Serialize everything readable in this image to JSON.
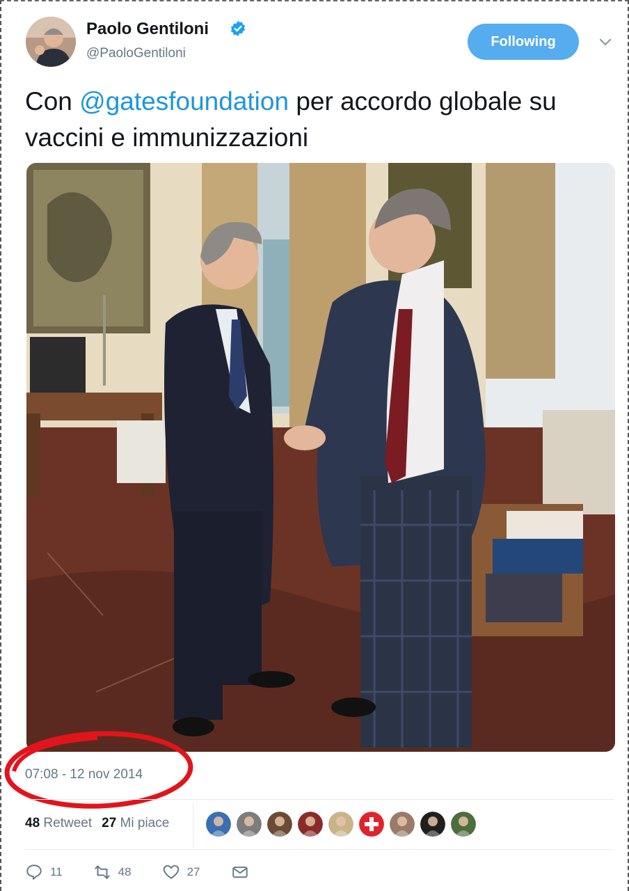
{
  "author": {
    "name": "Paolo Gentiloni",
    "handle": "@PaoloGentiloni",
    "verified": true,
    "follow_label": "Following"
  },
  "tweet": {
    "text_prefix": "Con ",
    "mention": "@gatesfoundation",
    "text_suffix": " per accordo globale su vaccini e immunizzazioni"
  },
  "timestamp": "07:08 - 12 nov 2014",
  "stats": {
    "retweets_count": "48",
    "retweets_label": "Retweet",
    "likes_count": "27",
    "likes_label": "Mi piace"
  },
  "likers": [
    {
      "color": "#3a6fb0"
    },
    {
      "color": "#7d7d7d"
    },
    {
      "color": "#6b4a36"
    },
    {
      "color": "#8a2b2b"
    },
    {
      "color": "#c9b48a"
    },
    {
      "color": "#e0242e"
    },
    {
      "color": "#9a7b6a"
    },
    {
      "color": "#1f1f1f"
    },
    {
      "color": "#4c6d3e"
    }
  ],
  "actions": {
    "reply_count": "11",
    "retweet_count": "48",
    "like_count": "27"
  },
  "colors": {
    "accent": "#1b95e0",
    "button": "#55acee",
    "annotation": "#e2141b"
  }
}
